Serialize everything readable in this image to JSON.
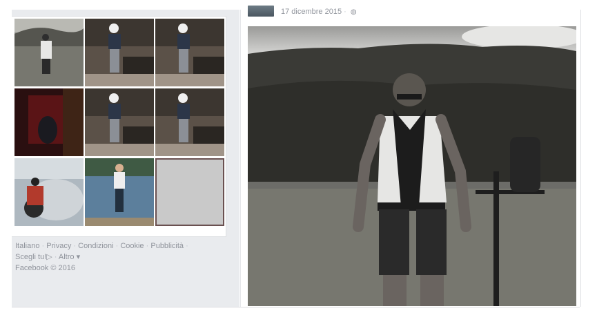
{
  "post": {
    "date": "17 dicembre 2015",
    "privacy_icon": "globe-icon"
  },
  "photo_grid": {
    "thumbnails": [
      {
        "subject": "man-in-field"
      },
      {
        "subject": "man-with-helmet-go-kart"
      },
      {
        "subject": "man-with-helmet-go-kart"
      },
      {
        "subject": "dark-red-room"
      },
      {
        "subject": "man-with-helmet-go-kart"
      },
      {
        "subject": "man-with-helmet-go-kart"
      },
      {
        "subject": "motorcycle-burnout"
      },
      {
        "subject": "man-by-lake"
      },
      {
        "subject": "blank-placeholder"
      }
    ]
  },
  "footer": {
    "links": [
      "Italiano",
      "Privacy",
      "Condizioni",
      "Cookie",
      "Pubblicità"
    ],
    "choices_label": "Scegli tu!",
    "more_label": "Altro",
    "copyright": "Facebook © 2016"
  },
  "colors": {
    "sidebar_bg": "#e9ebee",
    "text_muted": "#90949c"
  }
}
